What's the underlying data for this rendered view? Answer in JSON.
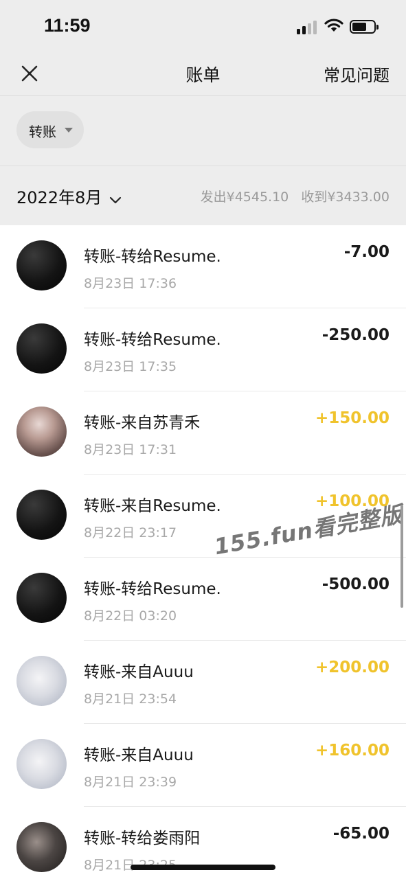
{
  "status_bar": {
    "time": "11:59"
  },
  "nav": {
    "title": "账单",
    "faq": "常见问题"
  },
  "filter": {
    "label": "转账"
  },
  "month": {
    "label": "2022年8月",
    "sent": "发出¥4545.10",
    "received": "收到¥3433.00"
  },
  "transactions": [
    {
      "title": "转账-转给Resume.",
      "date": "8月23日 17:36",
      "amount": "-7.00",
      "type": "expense",
      "avatar": "man"
    },
    {
      "title": "转账-转给Resume.",
      "date": "8月23日 17:35",
      "amount": "-250.00",
      "type": "expense",
      "avatar": "man"
    },
    {
      "title": "转账-来自苏青禾",
      "date": "8月23日 17:31",
      "amount": "+150.00",
      "type": "income",
      "avatar": "girl"
    },
    {
      "title": "转账-来自Resume.",
      "date": "8月22日 23:17",
      "amount": "+100.00",
      "type": "income",
      "avatar": "man"
    },
    {
      "title": "转账-转给Resume.",
      "date": "8月22日 03:20",
      "amount": "-500.00",
      "type": "expense",
      "avatar": "man"
    },
    {
      "title": "转账-来自Auuu",
      "date": "8月21日 23:54",
      "amount": "+200.00",
      "type": "income",
      "avatar": "cat"
    },
    {
      "title": "转账-来自Auuu",
      "date": "8月21日 23:39",
      "amount": "+160.00",
      "type": "income",
      "avatar": "cat"
    },
    {
      "title": "转账-转给娄雨阳",
      "date": "8月21日 23:25",
      "amount": "-65.00",
      "type": "expense",
      "avatar": "dark"
    }
  ],
  "watermark": "155.fun看完整版",
  "colors": {
    "income": "#f0c32c",
    "expense": "#1a1a1a",
    "header_bg": "#ededed"
  }
}
